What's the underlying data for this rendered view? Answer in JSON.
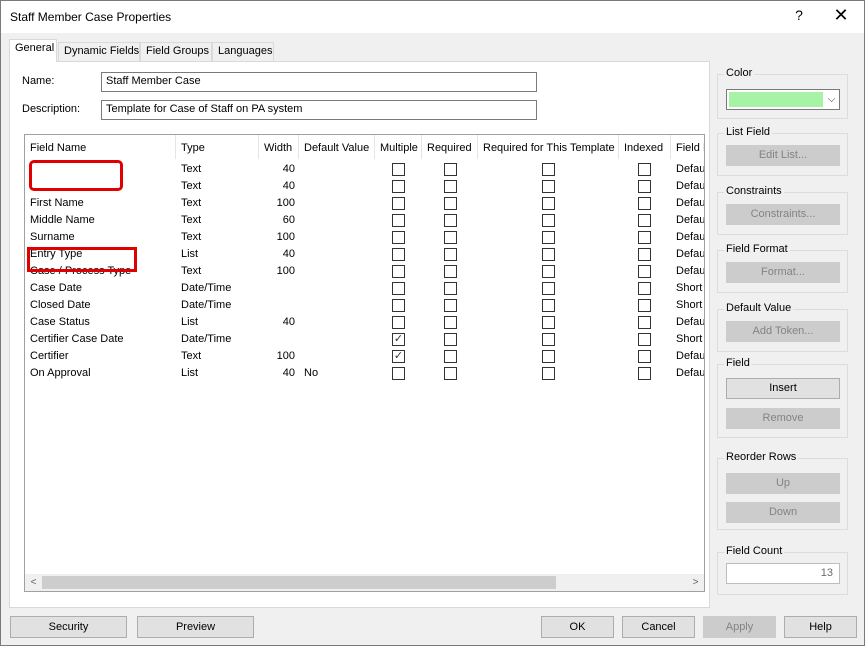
{
  "window": {
    "title": "Staff Member Case Properties",
    "help_glyph": "?",
    "close_glyph": "✕"
  },
  "tabs": [
    "General",
    "Dynamic Fields",
    "Field Groups",
    "Languages"
  ],
  "form": {
    "name_label": "Name:",
    "name_value": "Staff Member Case",
    "description_label": "Description:",
    "description_value": "Template for Case of Staff on PA system"
  },
  "grid": {
    "columns": [
      "Field Name",
      "Type",
      "Width",
      "Default Value",
      "Multiple",
      "Required",
      "Required for This Template",
      "Indexed",
      "Field I"
    ],
    "rows": [
      {
        "name": "",
        "type": "Text",
        "width": "40",
        "default": "",
        "multiple": false,
        "required": false,
        "req_template": false,
        "indexed": false,
        "field_i": "Defau"
      },
      {
        "name": "",
        "type": "Text",
        "width": "40",
        "default": "",
        "multiple": false,
        "required": false,
        "req_template": false,
        "indexed": false,
        "field_i": "Defau"
      },
      {
        "name": "First Name",
        "type": "Text",
        "width": "100",
        "default": "",
        "multiple": false,
        "required": false,
        "req_template": false,
        "indexed": false,
        "field_i": "Defau"
      },
      {
        "name": "Middle Name",
        "type": "Text",
        "width": "60",
        "default": "",
        "multiple": false,
        "required": false,
        "req_template": false,
        "indexed": false,
        "field_i": "Defau"
      },
      {
        "name": "Surname",
        "type": "Text",
        "width": "100",
        "default": "",
        "multiple": false,
        "required": false,
        "req_template": false,
        "indexed": false,
        "field_i": "Defau"
      },
      {
        "name": "Entry Type",
        "type": "List",
        "width": "40",
        "default": "",
        "multiple": false,
        "required": false,
        "req_template": false,
        "indexed": false,
        "field_i": "Defau"
      },
      {
        "name": "Case / Process Type",
        "type": "Text",
        "width": "100",
        "default": "",
        "multiple": false,
        "required": false,
        "req_template": false,
        "indexed": false,
        "field_i": "Defau"
      },
      {
        "name": "Case Date",
        "type": "Date/Time",
        "width": "",
        "default": "",
        "multiple": false,
        "required": false,
        "req_template": false,
        "indexed": false,
        "field_i": "Short"
      },
      {
        "name": "Closed Date",
        "type": "Date/Time",
        "width": "",
        "default": "",
        "multiple": false,
        "required": false,
        "req_template": false,
        "indexed": false,
        "field_i": "Short"
      },
      {
        "name": "Case Status",
        "type": "List",
        "width": "40",
        "default": "",
        "multiple": false,
        "required": false,
        "req_template": false,
        "indexed": false,
        "field_i": "Defau"
      },
      {
        "name": "Certifier Case Date",
        "type": "Date/Time",
        "width": "",
        "default": "",
        "multiple": true,
        "required": false,
        "req_template": false,
        "indexed": false,
        "field_i": "Short"
      },
      {
        "name": "Certifier",
        "type": "Text",
        "width": "100",
        "default": "",
        "multiple": true,
        "required": false,
        "req_template": false,
        "indexed": false,
        "field_i": "Defau"
      },
      {
        "name": "On Approval",
        "type": "List",
        "width": "40",
        "default": "No",
        "multiple": false,
        "required": false,
        "req_template": false,
        "indexed": false,
        "field_i": "Defau"
      }
    ],
    "scroll_left_glyph": "<",
    "scroll_right_glyph": ">"
  },
  "side": {
    "color": {
      "title": "Color",
      "value": "#a6f3a6",
      "arrow": "⌵"
    },
    "list_field": {
      "title": "List Field",
      "button": "Edit List..."
    },
    "constraints": {
      "title": "Constraints",
      "button": "Constraints..."
    },
    "field_format": {
      "title": "Field Format",
      "button": "Format..."
    },
    "default_value": {
      "title": "Default Value",
      "button": "Add Token..."
    },
    "field": {
      "title": "Field",
      "insert": "Insert",
      "remove": "Remove"
    },
    "reorder": {
      "title": "Reorder Rows",
      "up": "Up",
      "down": "Down"
    },
    "field_count": {
      "title": "Field Count",
      "value": "13"
    }
  },
  "footer": {
    "security": "Security",
    "preview": "Preview",
    "ok": "OK",
    "cancel": "Cancel",
    "apply": "Apply",
    "help": "Help"
  },
  "highlight_color": "#e00000"
}
